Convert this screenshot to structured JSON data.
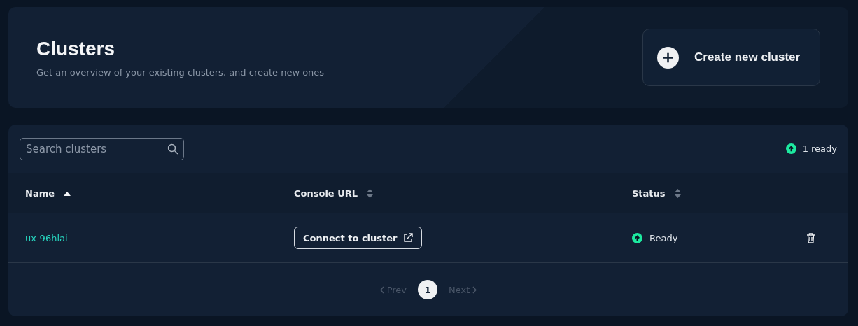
{
  "header": {
    "title": "Clusters",
    "subtitle": "Get an overview of your existing clusters, and create new ones",
    "create_button": {
      "label": "Create new cluster"
    }
  },
  "toolbar": {
    "search": {
      "placeholder": "Search clusters"
    },
    "ready_count": {
      "label": "1 ready",
      "color": "#1de9a0"
    }
  },
  "table": {
    "columns": [
      {
        "label": "Name",
        "sorted": true
      },
      {
        "label": "Console URL",
        "sorted": false
      },
      {
        "label": "Status",
        "sorted": false
      }
    ],
    "rows": [
      {
        "name": "ux-96hlai",
        "connect_label": "Connect to cluster",
        "status": "Ready",
        "color": "#1de9a0"
      }
    ]
  },
  "pagination": {
    "prev": {
      "label": "Prev",
      "disabled": true
    },
    "pages": [
      {
        "label": "1",
        "selected": true
      }
    ],
    "next": {
      "label": "Next",
      "disabled": true
    }
  }
}
